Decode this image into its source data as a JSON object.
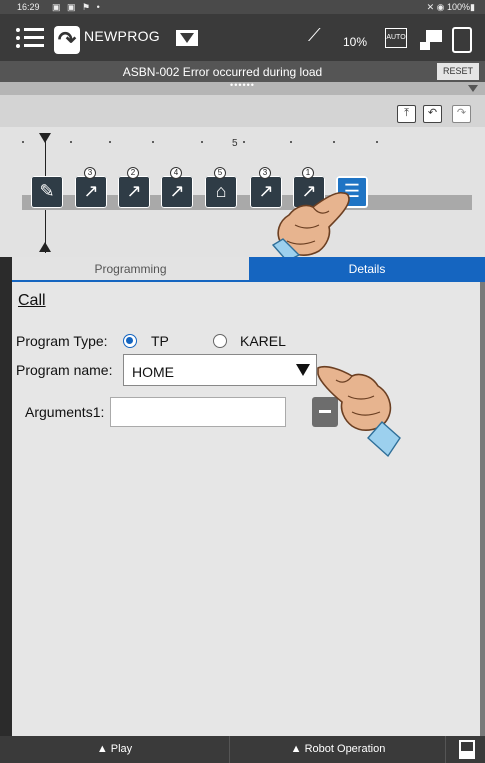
{
  "status": {
    "time": "16:29",
    "indicators": "▣ ▣ ⚑ •",
    "battery": "✕ ◉ 100%▮"
  },
  "appbar": {
    "program_name": "NEWPROG",
    "override_percent": "10%",
    "mode_badge": "AUTO"
  },
  "alarm": {
    "message": "ASBN-002  Error occurred during load",
    "reset_label": "RESET"
  },
  "handle_dots": "••••••",
  "timeline": {
    "marker_label": "5",
    "steps": [
      {
        "glyph": "✎",
        "badge": ""
      },
      {
        "glyph": "↗",
        "badge": "3"
      },
      {
        "glyph": "↗",
        "badge": "2"
      },
      {
        "glyph": "↗",
        "badge": "4"
      },
      {
        "glyph": "⌂",
        "badge": "5"
      },
      {
        "glyph": "↗",
        "badge": "3"
      },
      {
        "glyph": "↗",
        "badge": "1"
      },
      {
        "glyph": "☰",
        "badge": ""
      }
    ]
  },
  "tabs": {
    "programming": "Programming",
    "details": "Details"
  },
  "details": {
    "title": "Call",
    "program_type_label": "Program Type:",
    "type_tp": "TP",
    "type_karel": "KAREL",
    "selected_type": "TP",
    "program_name_label": "Program name:",
    "program_name_value": "HOME",
    "arguments_label": "Arguments1:",
    "arguments_value": ""
  },
  "bottom": {
    "play": "▲ Play",
    "robot_operation": "▲ Robot Operation"
  },
  "colors": {
    "accent": "#1565c0",
    "step": "#2f3c46",
    "selected_step": "#1f74c4"
  },
  "icons": [
    "menu-icon",
    "redo-icon",
    "dropdown-icon",
    "tool-icon",
    "auto-mode-icon",
    "teach-pendant-icon",
    "touch-icon",
    "upload-icon",
    "undo-icon",
    "redo-small-icon",
    "hand-pointer-icon",
    "panel-icon"
  ]
}
